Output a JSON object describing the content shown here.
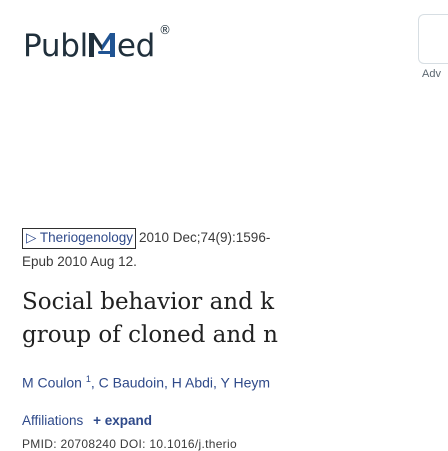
{
  "header": {
    "logo_prefix": "Publ",
    "logo_suffix": "ed",
    "logo_reg": "®",
    "advanced_label": "Adv"
  },
  "article": {
    "journal_label": "Theriogenology",
    "citation_text": "2010 Dec;74(9):1596-",
    "epub_text": "Epub 2010 Aug 12.",
    "title_line1": "Social behavior and k",
    "title_line2": "group of cloned and n",
    "author1": "M Coulon",
    "author1_sup": "1",
    "authors_rest": ", C Baudoin, H Abdi, Y Heym",
    "affiliations_label": "Affiliations",
    "expand_label": "+ expand",
    "ids_text": "PMID: 20708240  DOI: 10.1016/j.therio"
  },
  "colors": {
    "link": "#2f4a8a",
    "logo": "#20303c",
    "logo_accent": "#205493"
  }
}
